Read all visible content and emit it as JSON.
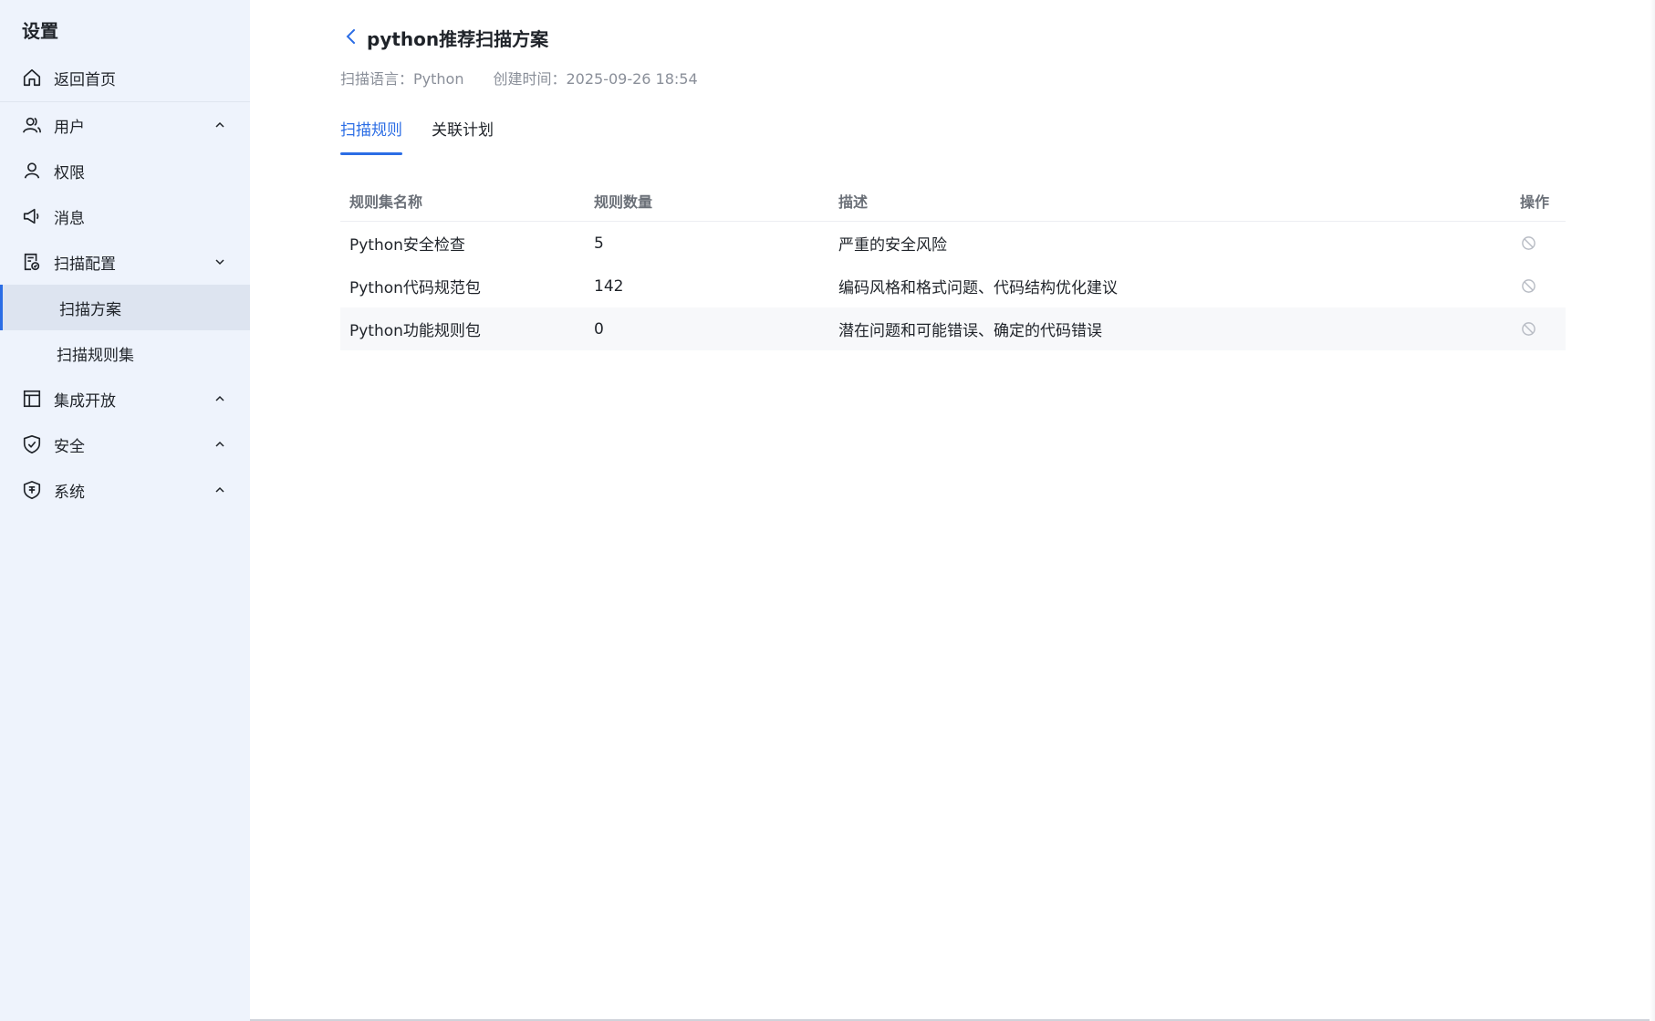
{
  "sidebar": {
    "title": "设置",
    "items": [
      {
        "label": "返回首页",
        "icon": "home-icon"
      },
      {
        "label": "用户",
        "icon": "users-icon",
        "chevron": "up"
      },
      {
        "label": "权限",
        "icon": "person-icon"
      },
      {
        "label": "消息",
        "icon": "megaphone-icon"
      },
      {
        "label": "扫描配置",
        "icon": "scan-config-icon",
        "chevron": "down"
      },
      {
        "label": "集成开放",
        "icon": "layout-icon",
        "chevron": "up"
      },
      {
        "label": "安全",
        "icon": "shield-check-icon",
        "chevron": "up"
      },
      {
        "label": "系统",
        "icon": "system-shield-icon",
        "chevron": "up"
      }
    ],
    "sub_items": [
      {
        "label": "扫描方案",
        "active": true
      },
      {
        "label": "扫描规则集",
        "active": false
      }
    ]
  },
  "main": {
    "title": "python推荐扫描方案",
    "meta": {
      "language": "扫描语言：Python",
      "created": "创建时间：2025-09-26 18:54"
    },
    "tabs": [
      {
        "label": "扫描规则",
        "active": true
      },
      {
        "label": "关联计划",
        "active": false
      }
    ],
    "table": {
      "headers": [
        "规则集名称",
        "规则数量",
        "描述",
        "操作"
      ],
      "rows": [
        {
          "name": "Python安全检查",
          "count": "5",
          "desc": "严重的安全风险"
        },
        {
          "name": "Python代码规范包",
          "count": "142",
          "desc": "编码风格和格式问题、代码结构优化建议"
        },
        {
          "name": "Python功能规则包",
          "count": "0",
          "desc": "潜在问题和可能错误、确定的代码错误"
        }
      ]
    }
  },
  "colors": {
    "accent": "#2b6de5",
    "sidebar_bg": "#eef3fc",
    "active_bg": "#dde4f0"
  }
}
